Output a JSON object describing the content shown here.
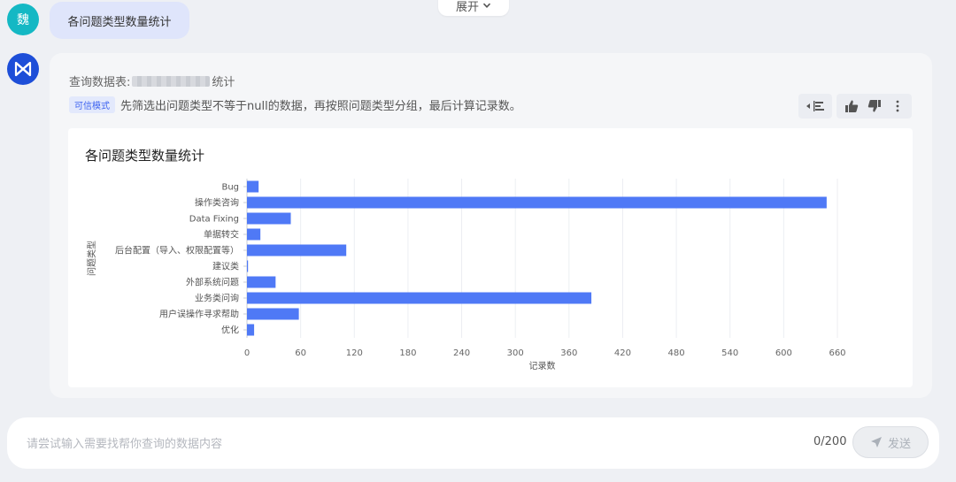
{
  "top": {
    "expand_label": "展开"
  },
  "user": {
    "avatar_char": "魏",
    "message": "各问题类型数量统计"
  },
  "answer": {
    "query_prefix": "查询数据表:",
    "query_suffix": "统计",
    "trust_badge": "可信模式",
    "description": "先筛选出问题类型不等于null的数据，再按照问题类型分组，最后计算记录数。"
  },
  "input": {
    "placeholder": "请尝试输入需要找帮你查询的数据内容",
    "value": "",
    "char_count": "0/200",
    "send_label": "发送"
  },
  "colors": {
    "accent": "#4f79f6",
    "user_avatar": "#14b8c4",
    "bot_avatar": "#1d4ed8"
  },
  "chart_data": {
    "type": "bar",
    "orientation": "horizontal",
    "title": "各问题类型数量统计",
    "xlabel": "记录数",
    "ylabel": "问题类型",
    "categories": [
      "Bug",
      "操作类咨询",
      "Data Fixing",
      "单据转交",
      "后台配置（导入、权限配置等）",
      "建议类",
      "外部系统问题",
      "业务类问询",
      "用户误操作寻求帮助",
      "优化"
    ],
    "values": [
      13,
      648,
      49,
      15,
      111,
      1,
      32,
      385,
      58,
      8
    ],
    "xticks": [
      0,
      60,
      120,
      180,
      240,
      300,
      360,
      420,
      480,
      540,
      600,
      660
    ],
    "xlim": [
      0,
      660
    ],
    "grid": true,
    "legend": "none"
  }
}
